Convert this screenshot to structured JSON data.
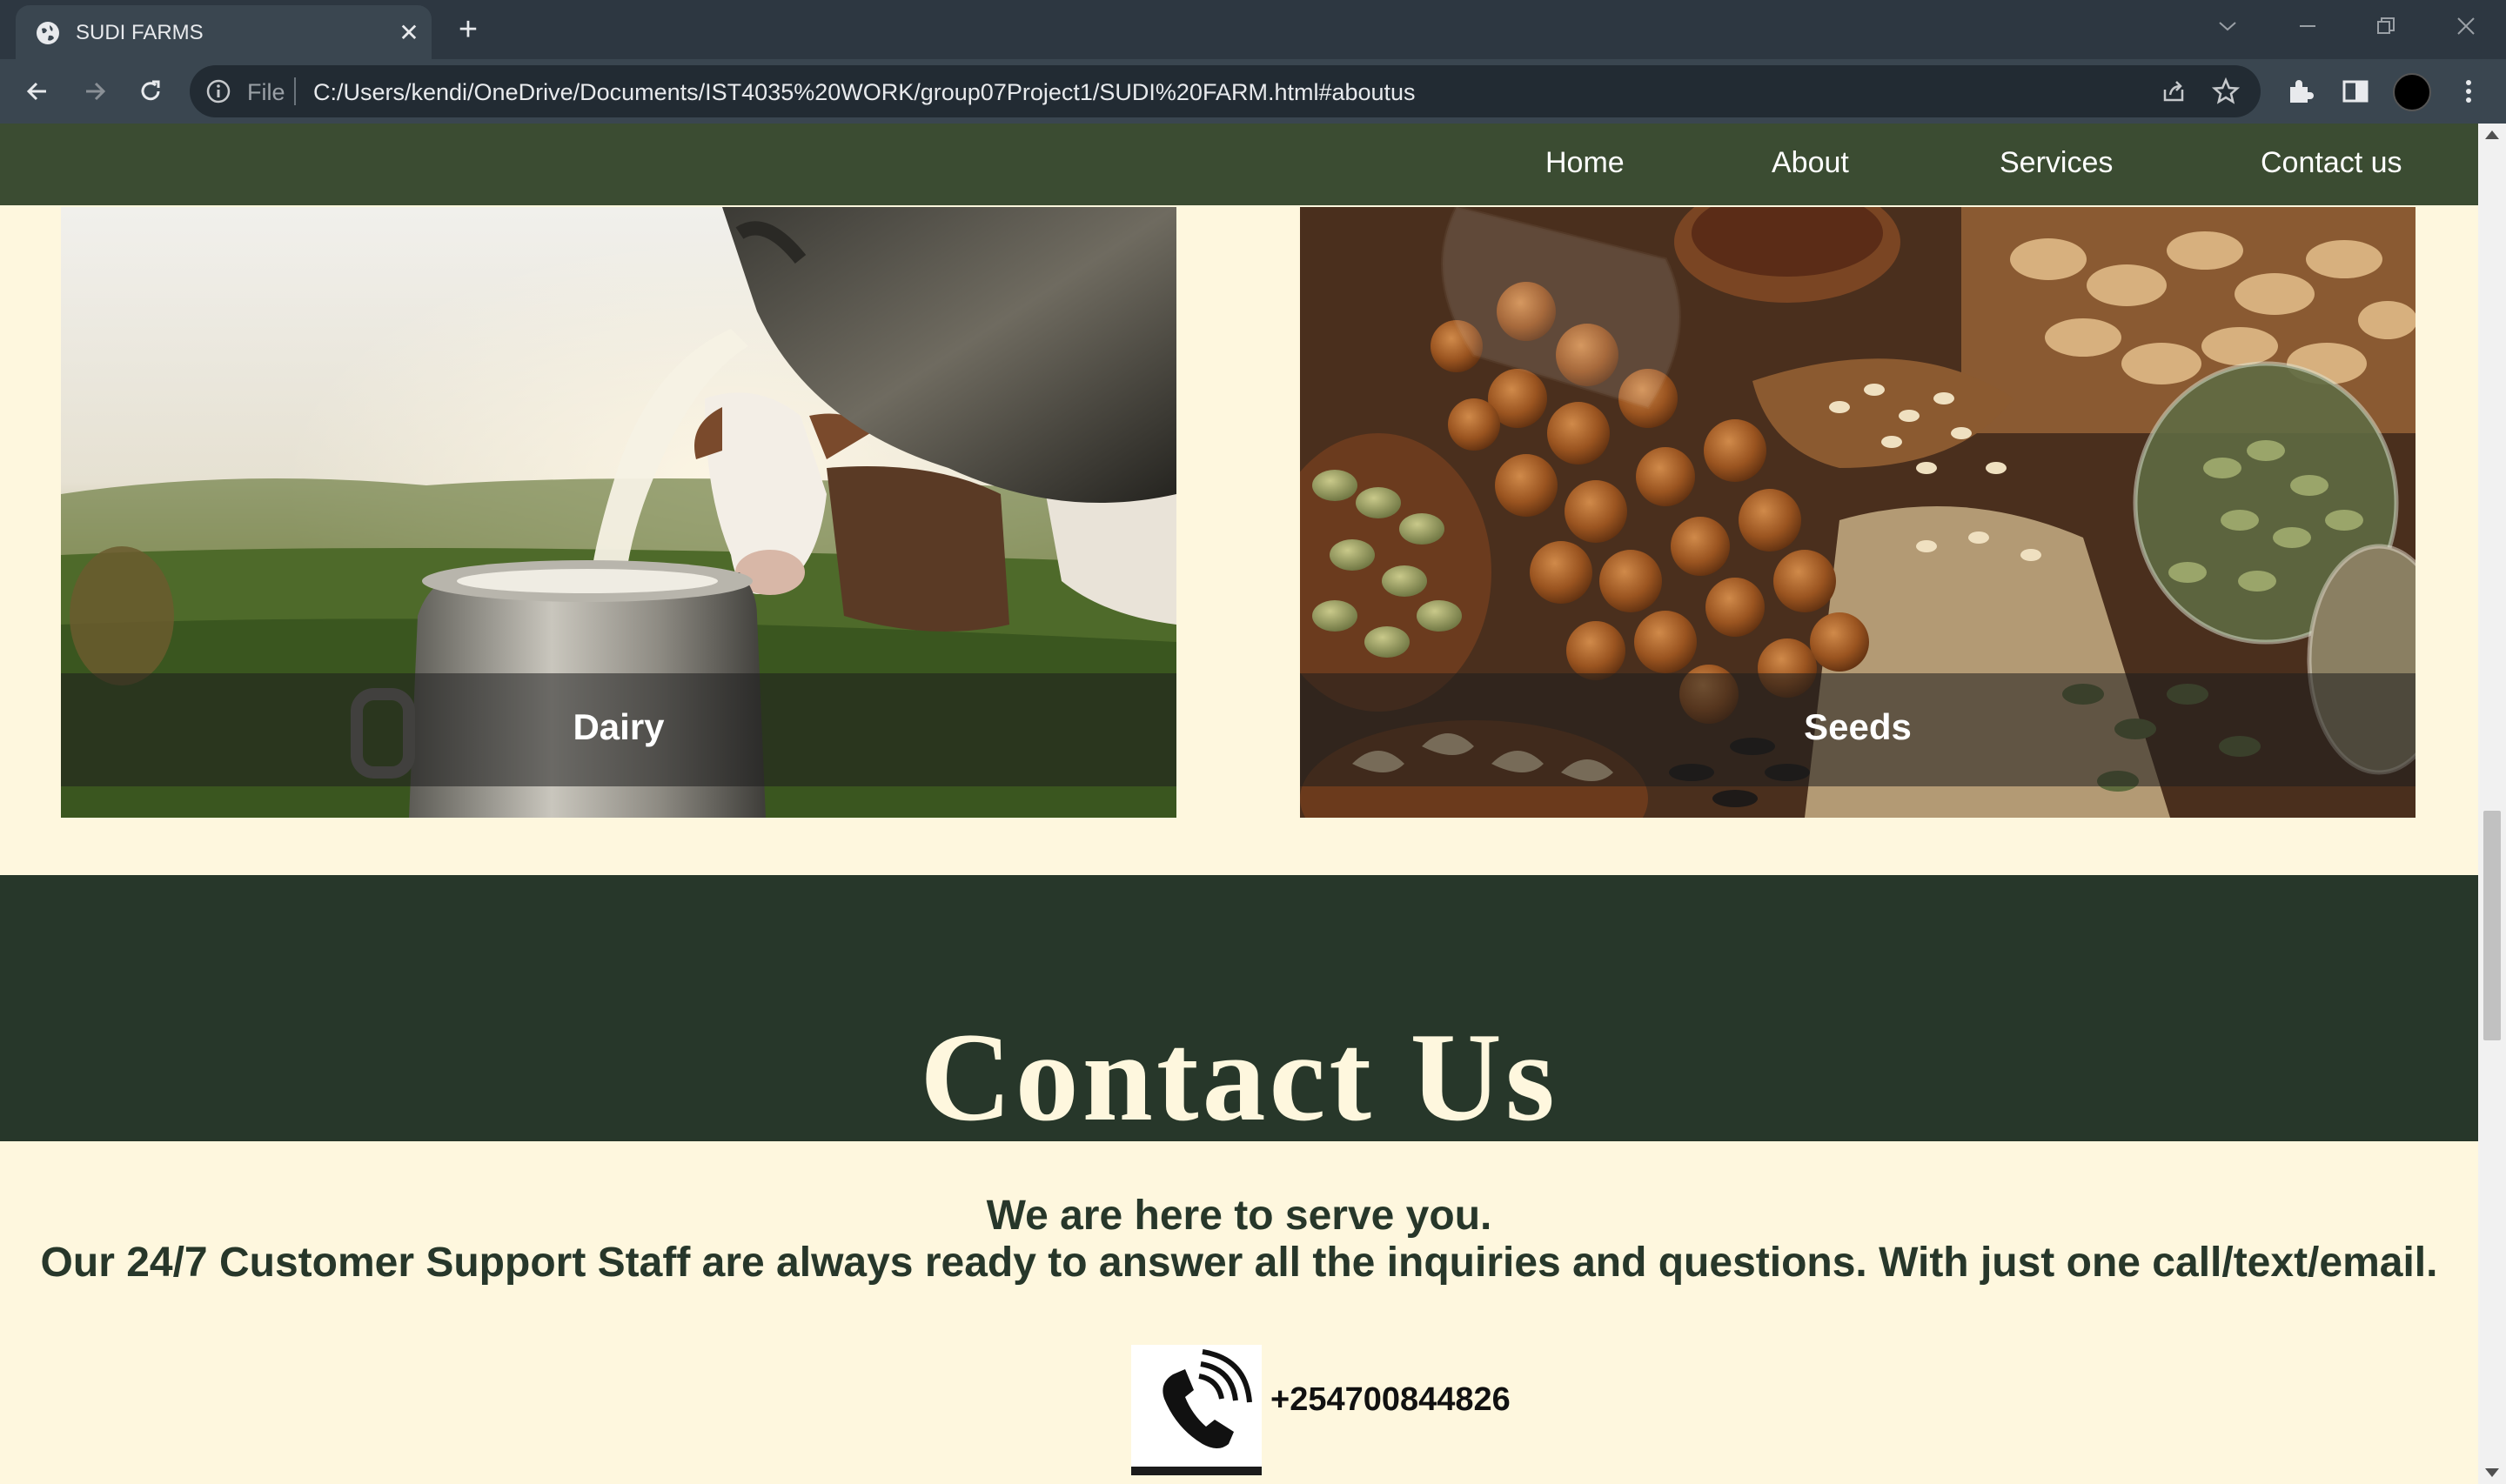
{
  "browser": {
    "tab_title": "SUDI FARMS",
    "tab_close": "✕",
    "new_tab": "+",
    "site_info_label": "File",
    "url": "C:/Users/kendi/OneDrive/Documents/IST4035%20WORK/group07Project1/SUDI%20FARM.html#aboutus"
  },
  "nav": {
    "links": [
      "Home",
      "About",
      "Services",
      "Contact us"
    ]
  },
  "cards": [
    {
      "label": "Dairy"
    },
    {
      "label": "Seeds"
    }
  ],
  "contact": {
    "title": "Contact Us",
    "line1": "We are here to serve you.",
    "line2": "Our 24/7 Customer Support Staff are always ready to answer all the inquiries and questions. With just one call/text/email.",
    "phone": "+254700844826"
  },
  "colors": {
    "navbar": "#3b4c32",
    "contact_band": "#27372a",
    "page_bg": "#fef7de"
  }
}
